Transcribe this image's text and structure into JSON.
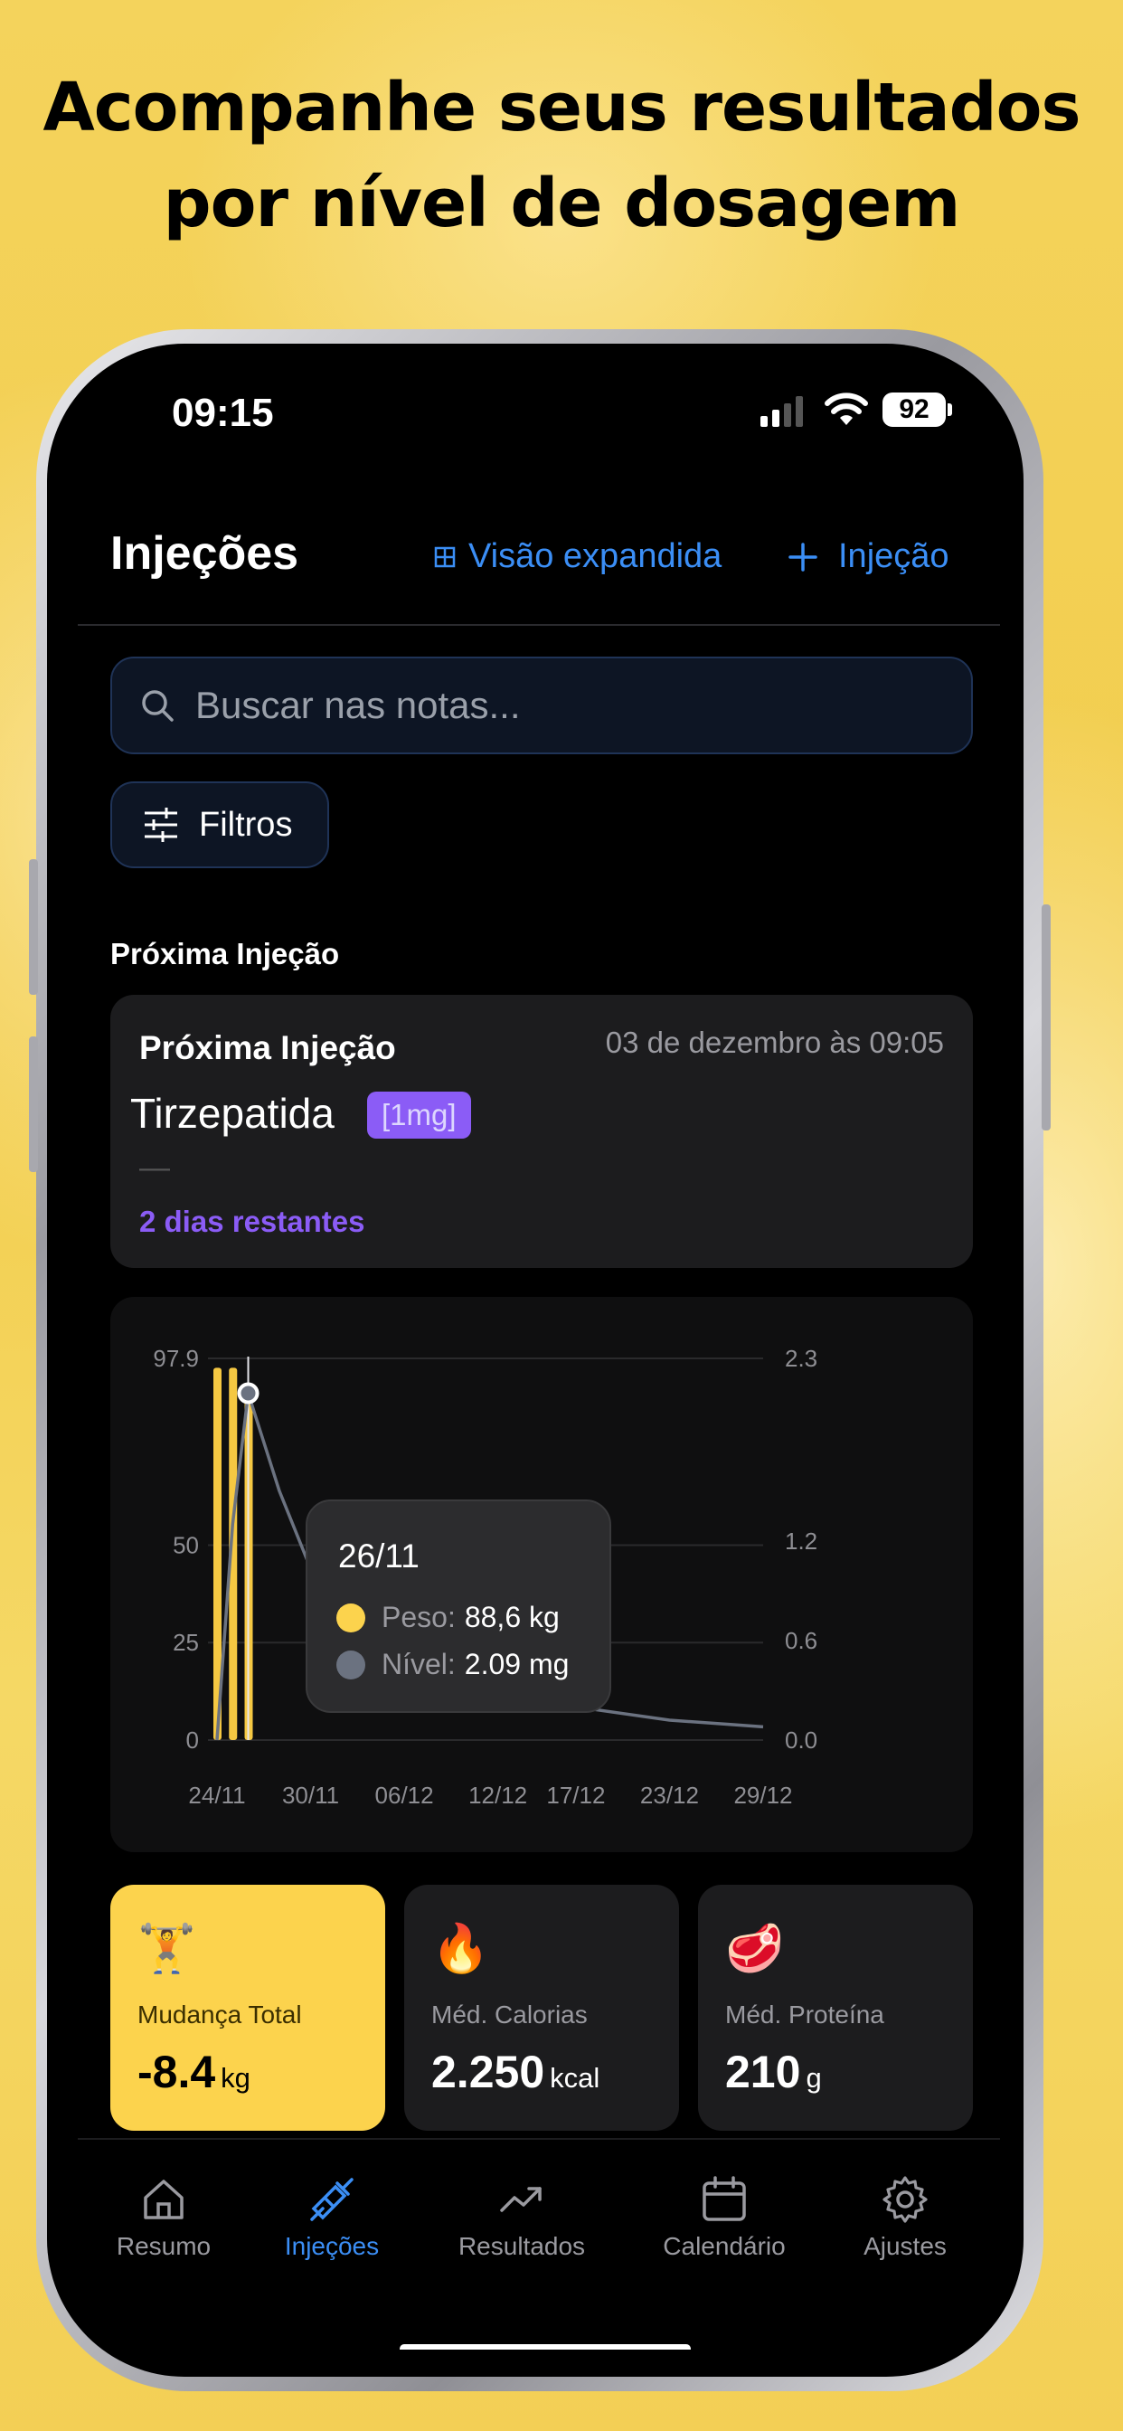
{
  "headline": {
    "line1": "Acompanhe seus resultados",
    "line2": "por nível de dosagem"
  },
  "status_bar": {
    "time": "09:15",
    "battery": "92"
  },
  "header": {
    "title": "Injeções",
    "expand_label": "Visão expandida",
    "add_label": "Injeção"
  },
  "search": {
    "placeholder": "Buscar nas notas..."
  },
  "filters": {
    "label": "Filtros"
  },
  "next_injection": {
    "section_label": "Próxima Injeção",
    "card_title": "Próxima Injeção",
    "date": "03 de dezembro às 09:05",
    "drug": "Tirzepatida",
    "dose_badge": "[1mg]",
    "note": "—",
    "remaining": "2 dias restantes"
  },
  "chart_data": {
    "type": "line",
    "x": [
      "24/11",
      "30/11",
      "06/12",
      "12/12",
      "17/12",
      "23/12",
      "29/12"
    ],
    "left_axis": {
      "ticks": [
        "97.9",
        "50",
        "25",
        "0"
      ]
    },
    "right_axis": {
      "ticks": [
        "2.3",
        "1.2",
        "0.6",
        "0.0"
      ]
    },
    "series": [
      {
        "name": "Peso",
        "color": "#f5c842",
        "type": "bar",
        "points": [
          {
            "x": "24/11",
            "y": 95.5
          },
          {
            "x": "25/11",
            "y": 95.5
          },
          {
            "x": "26/11",
            "y": 88.6
          }
        ]
      },
      {
        "name": "Nível",
        "color": "#6b7280",
        "type": "line",
        "axis": "right",
        "points": [
          {
            "x": "24/11",
            "y": 0.0
          },
          {
            "x": "25/11",
            "y": 1.3
          },
          {
            "x": "26/11",
            "y": 2.09
          },
          {
            "x": "28/11",
            "y": 1.5
          },
          {
            "x": "01/12",
            "y": 0.8
          },
          {
            "x": "06/12",
            "y": 0.45
          },
          {
            "x": "12/12",
            "y": 0.3
          },
          {
            "x": "17/12",
            "y": 0.2
          },
          {
            "x": "23/12",
            "y": 0.12
          },
          {
            "x": "29/12",
            "y": 0.08
          }
        ]
      }
    ],
    "tooltip": {
      "date": "26/11",
      "weight_label": "Peso:",
      "weight_value": "88,6 kg",
      "level_label": "Nível:",
      "level_value": "2.09 mg"
    }
  },
  "stats": [
    {
      "label": "Mudança Total",
      "value": "-8.4",
      "unit": "kg",
      "icon": "weightlifter-icon",
      "bg": "#fcd34d"
    },
    {
      "label": "Méd. Calorias",
      "value": "2.250",
      "unit": "kcal",
      "icon": "fire-icon",
      "bg": "#1c1c1e"
    },
    {
      "label": "Méd. Proteína",
      "value": "210",
      "unit": "g",
      "icon": "meat-icon",
      "bg": "#1c1c1e"
    }
  ],
  "tabs": [
    {
      "label": "Resumo",
      "active": false
    },
    {
      "label": "Injeções",
      "active": true
    },
    {
      "label": "Resultados",
      "active": false
    },
    {
      "label": "Calendário",
      "active": false
    },
    {
      "label": "Ajustes",
      "active": false
    }
  ],
  "colors": {
    "accent_blue": "#3b8ef5",
    "accent_purple": "#8b5cf6",
    "weight_yellow": "#f5c842",
    "background_yellow": "#f3cf52"
  }
}
